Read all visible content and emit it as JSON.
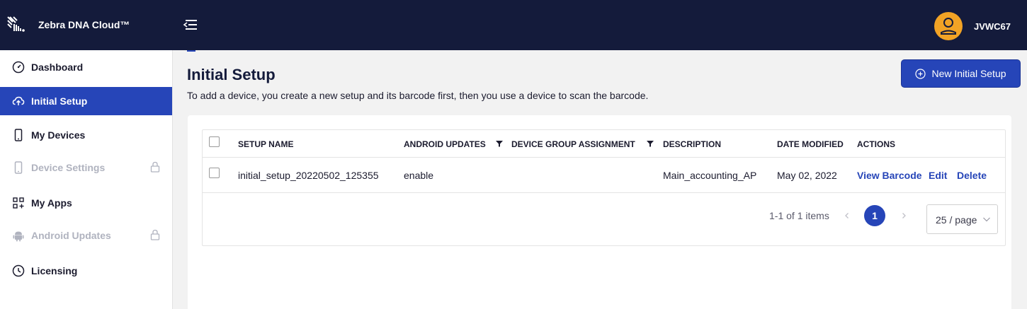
{
  "header": {
    "brand": "Zebra DNA Cloud™",
    "username": "JVWC67"
  },
  "sidebar": {
    "items": [
      {
        "label": "Dashboard",
        "icon": "dashboard-icon",
        "state": "normal"
      },
      {
        "label": "Initial Setup",
        "icon": "cloud-upload-icon",
        "state": "active"
      },
      {
        "label": "My Devices",
        "icon": "phone-icon",
        "state": "normal"
      },
      {
        "label": "Device Settings",
        "icon": "phone-icon",
        "state": "disabled"
      },
      {
        "label": "My Apps",
        "icon": "apps-icon",
        "state": "normal"
      },
      {
        "label": "Android Updates",
        "icon": "android-icon",
        "state": "disabled"
      },
      {
        "label": "Licensing",
        "icon": "license-icon",
        "state": "normal"
      }
    ]
  },
  "page": {
    "title": "Initial Setup",
    "description": "To add a device, you create a new setup and its barcode first, then you use a device to scan the barcode.",
    "new_button_label": "New Initial Setup"
  },
  "table": {
    "columns": [
      "SETUP NAME",
      "ANDROID UPDATES",
      "DEVICE GROUP ASSIGNMENT",
      "DESCRIPTION",
      "DATE MODIFIED",
      "ACTIONS"
    ],
    "rows": [
      {
        "setup_name": "initial_setup_20220502_125355",
        "android_updates": "enable",
        "device_group_assignment": "",
        "description": "Main_accounting_AP",
        "date_modified": "May 02, 2022",
        "actions": [
          "View Barcode",
          "Edit",
          "Delete"
        ]
      }
    ]
  },
  "pagination": {
    "summary": "1-1 of 1 items",
    "current_page": "1",
    "page_size": "25 / page"
  },
  "colors": {
    "topbar": "#141b3b",
    "accent": "#2645b8",
    "avatar": "#f2a325"
  }
}
